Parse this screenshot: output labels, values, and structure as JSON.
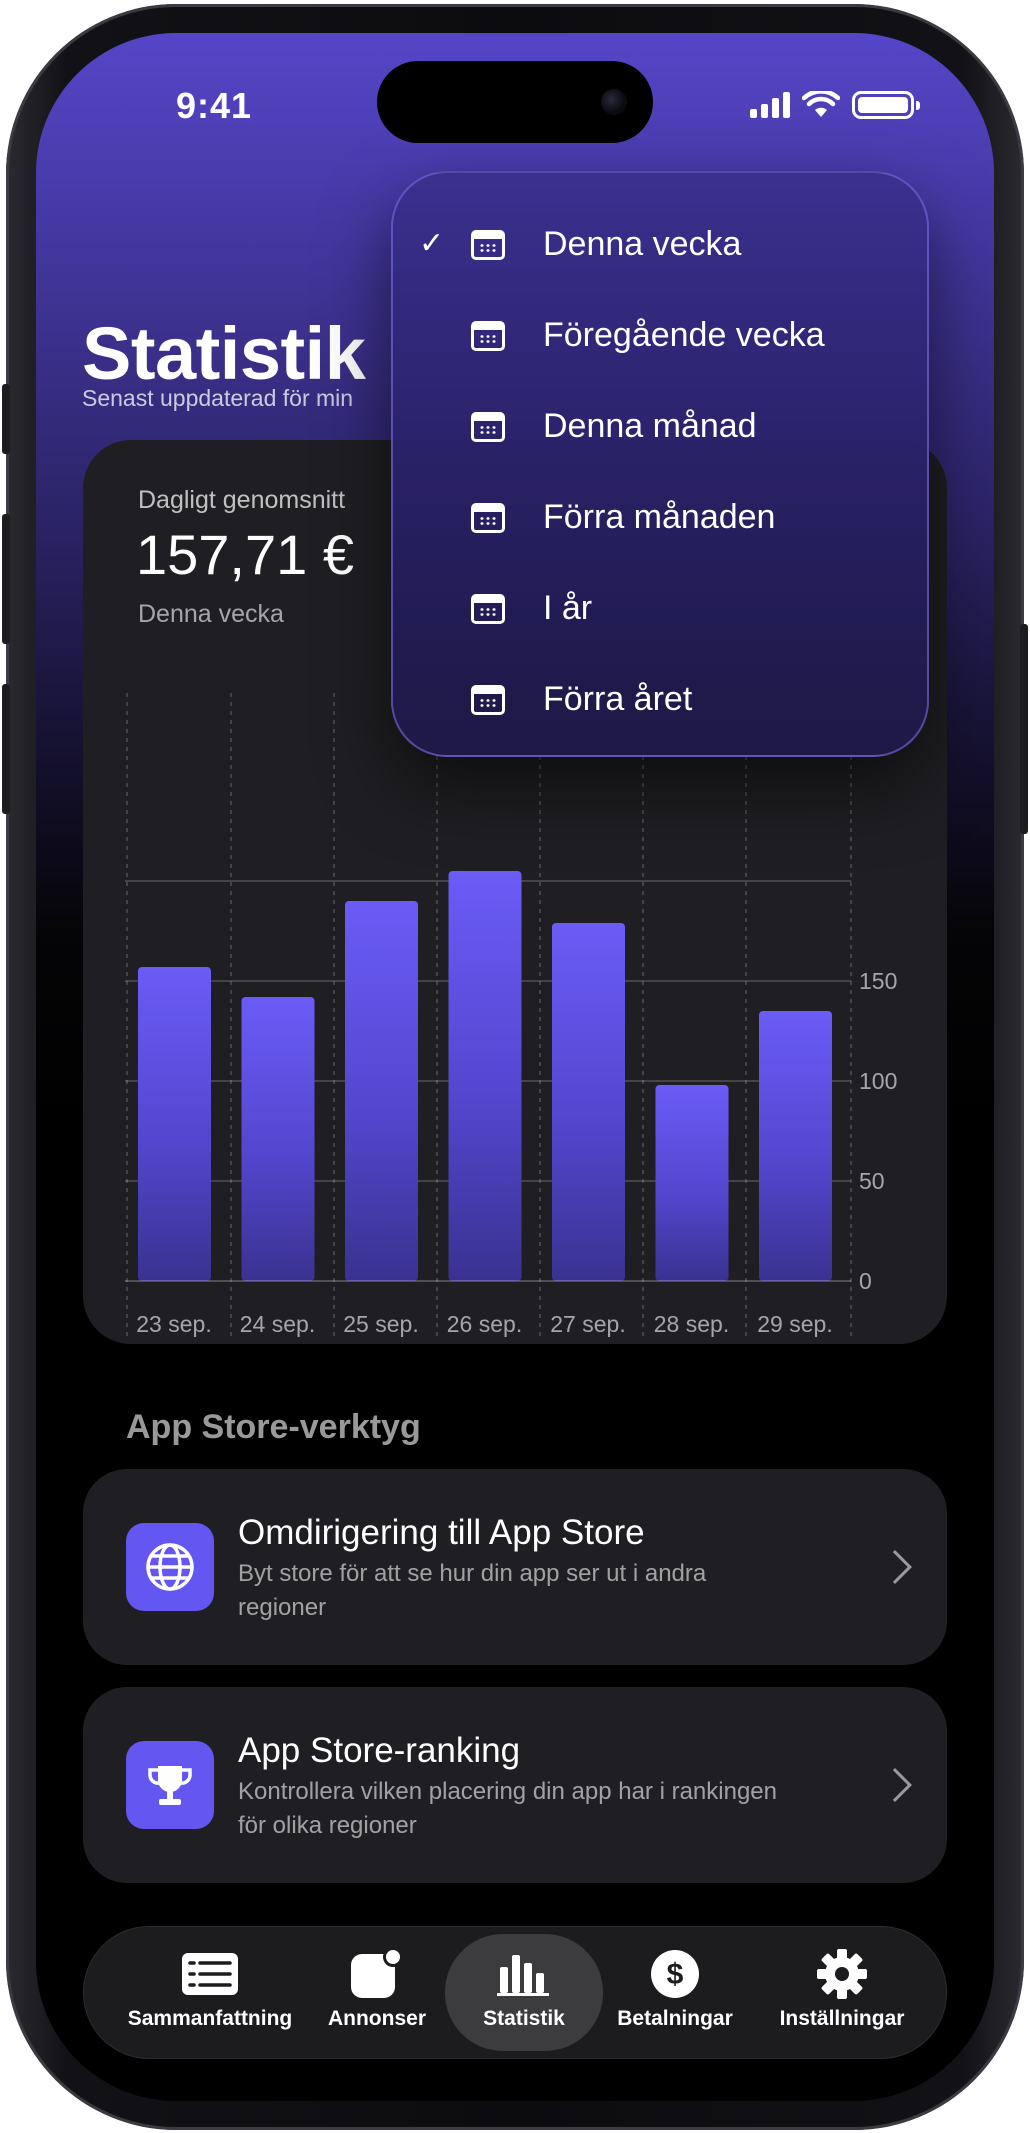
{
  "status_bar": {
    "time": "9:41"
  },
  "header": {
    "title": "Statistik",
    "subtitle": "Senast uppdaterad för min"
  },
  "stats_card": {
    "label": "Dagligt genomsnitt",
    "value": "157,71 €",
    "period": "Denna vecka"
  },
  "chart_data": {
    "type": "bar",
    "categories": [
      "23 sep.",
      "24 sep.",
      "25 sep.",
      "26 sep.",
      "27 sep.",
      "28 sep.",
      "29 sep."
    ],
    "values": [
      157,
      142,
      190,
      205,
      179,
      98,
      135
    ],
    "ylim": [
      0,
      200
    ],
    "yticks": [
      0,
      50,
      100,
      150
    ],
    "bar_color": "#6456f0",
    "grid": true
  },
  "period_menu": {
    "selected_index": 0,
    "items": [
      {
        "label": "Denna vecka",
        "icon": "calendar-icon"
      },
      {
        "label": "Föregående vecka",
        "icon": "calendar-icon"
      },
      {
        "label": "Denna månad",
        "icon": "calendar-icon"
      },
      {
        "label": "Förra månaden",
        "icon": "calendar-icon"
      },
      {
        "label": "I år",
        "icon": "calendar-icon"
      },
      {
        "label": "Förra året",
        "icon": "calendar-icon"
      }
    ]
  },
  "tools_section": {
    "title": "App Store-verktyg",
    "items": [
      {
        "title": "Omdirigering till App Store",
        "description": "Byt store för att se hur din app ser ut i andra regioner",
        "icon": "globe-icon"
      },
      {
        "title": "App Store-ranking",
        "description": "Kontrollera vilken placering din app har i rankingen för olika regioner",
        "icon": "trophy-icon"
      }
    ]
  },
  "tab_bar": {
    "active_index": 2,
    "tabs": [
      {
        "label": "Sammanfattning",
        "icon": "list-icon"
      },
      {
        "label": "Annonser",
        "icon": "app-badge-icon"
      },
      {
        "label": "Statistik",
        "icon": "bar-chart-icon"
      },
      {
        "label": "Betalningar",
        "icon": "dollar-icon"
      },
      {
        "label": "Inställningar",
        "icon": "gear-icon"
      }
    ]
  },
  "colors": {
    "accent": "#6456f0",
    "header_gradient_top": "#5546c8",
    "card_background": "#1f1f23",
    "background": "#000000"
  }
}
